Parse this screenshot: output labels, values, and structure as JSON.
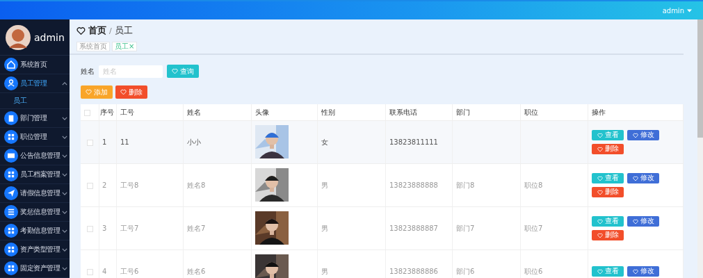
{
  "header": {
    "user": "admin"
  },
  "sidebar": {
    "user": "admin",
    "items": [
      {
        "label": "系统首页",
        "selected": false
      },
      {
        "label": "员工管理",
        "selected": true,
        "expanded": true,
        "children": [
          {
            "label": "员工",
            "selected": true
          }
        ]
      },
      {
        "label": "部门管理",
        "selected": false,
        "expanded": false
      },
      {
        "label": "职位管理",
        "selected": false,
        "expanded": false
      },
      {
        "label": "公告信息管理",
        "selected": false,
        "expanded": false
      },
      {
        "label": "员工档案管理",
        "selected": false,
        "expanded": false
      },
      {
        "label": "请假信息管理",
        "selected": false,
        "expanded": false
      },
      {
        "label": "奖惩信息管理",
        "selected": false,
        "expanded": false
      },
      {
        "label": "考勤信息管理",
        "selected": false,
        "expanded": false
      },
      {
        "label": "资产类型管理",
        "selected": false,
        "expanded": false
      },
      {
        "label": "固定资产管理",
        "selected": false,
        "expanded": false
      }
    ]
  },
  "breadcrumb": {
    "home": "首页",
    "separator": "/",
    "current": "员工"
  },
  "tags": [
    {
      "label": "系统首页",
      "selected": false
    },
    {
      "label": "员工",
      "close": "×",
      "selected": true
    }
  ],
  "search": {
    "label": "姓名",
    "placeholder": "姓名",
    "button": "查询"
  },
  "toolbar": [
    {
      "label": "添加",
      "kind": "add"
    },
    {
      "label": "删除",
      "kind": "delete"
    }
  ],
  "table": {
    "all_checked": false,
    "columns": [
      "序号",
      "工号",
      "姓名",
      "头像",
      "性别",
      "联系电话",
      "部门",
      "职位",
      "操作"
    ],
    "rows": [
      {
        "checked": false,
        "hovered": true,
        "index": "1",
        "number": "11",
        "name": "小小",
        "gender": "女",
        "phone": "13823811111",
        "actions": [
          "查看",
          "修改",
          "删除"
        ]
      },
      {
        "checked": false,
        "hovered": false,
        "index": "2",
        "number": "工号8",
        "name": "姓名8",
        "gender": "男",
        "phone": "13823888888",
        "department": "部门8",
        "position": "职位8",
        "actions": [
          "查看",
          "修改",
          "删除"
        ]
      },
      {
        "checked": false,
        "hovered": false,
        "index": "3",
        "number": "工号7",
        "name": "姓名7",
        "gender": "男",
        "phone": "13823888887",
        "department": "部门7",
        "position": "职位7",
        "actions": [
          "查看",
          "修改",
          "删除"
        ]
      },
      {
        "checked": false,
        "hovered": false,
        "index": "4",
        "number": "工号6",
        "name": "姓名6",
        "gender": "男",
        "phone": "13823888886",
        "department": "部门6",
        "position": "职位6",
        "actions": [
          "查看",
          "修改"
        ]
      }
    ]
  }
}
